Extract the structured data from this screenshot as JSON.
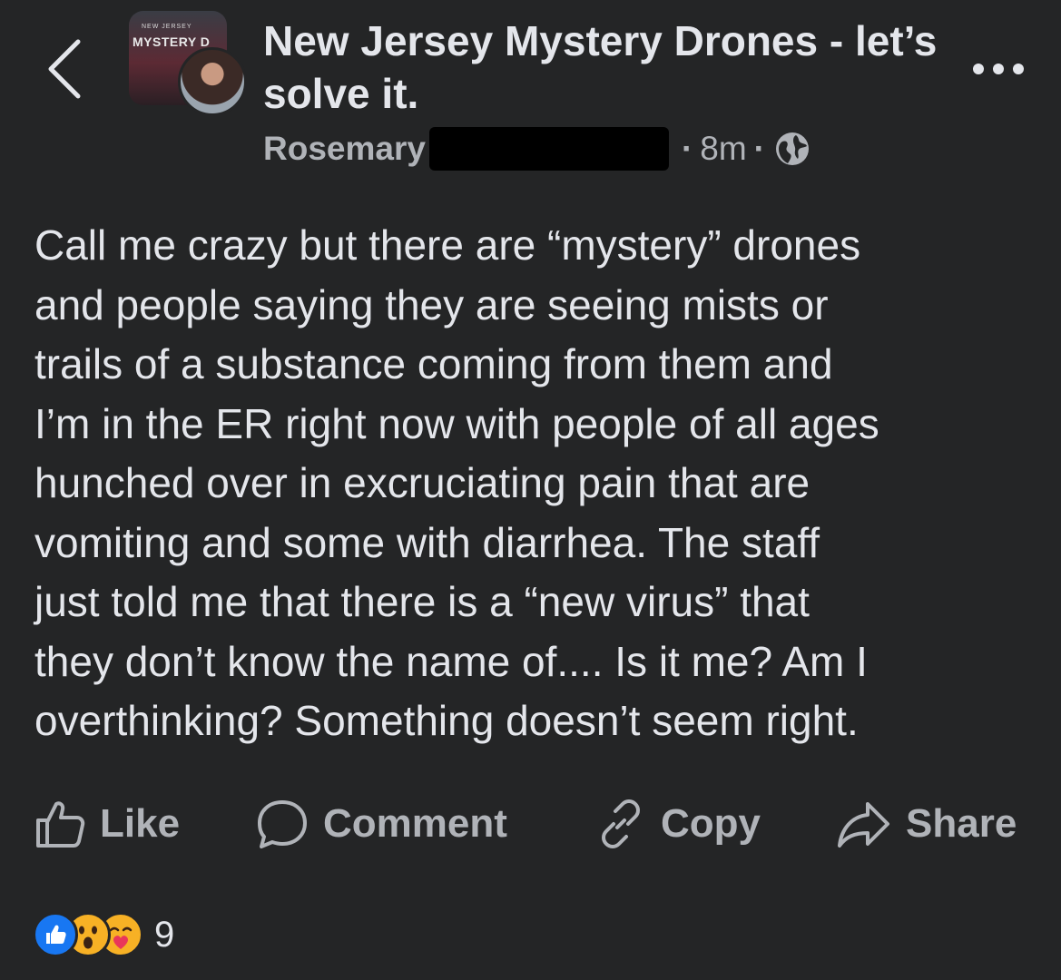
{
  "header": {
    "group_name": "New Jersey Mystery Drones - let’s solve it.",
    "group_avatar_text_small": "NEW JERSEY",
    "group_avatar_text_big": "MYSTERY D",
    "author": "Rosemary",
    "time_ago": "8m",
    "separator": "·"
  },
  "post": {
    "text": "Call me crazy but there are “mystery” drones\nand people saying they are seeing mists or\ntrails of a substance coming from them and\nI’m in the ER right now with people of all ages\nhunched over in excruciating pain that are\nvomiting and some with diarrhea. The staff\njust told me that there is a “new virus” that\nthey don’t know the name of.... Is it me? Am I\noverthinking? Something doesn’t seem right."
  },
  "actions": {
    "like": "Like",
    "comment": "Comment",
    "copy": "Copy",
    "share": "Share"
  },
  "reactions": {
    "count": "9",
    "types": [
      "like-icon",
      "wow-icon",
      "care-icon"
    ]
  },
  "colors": {
    "background": "#242526",
    "primary_text": "#e4e6eb",
    "secondary_text": "#b0b3b8",
    "like_blue": "#1877f2",
    "reaction_yellow": "#f7b125"
  }
}
